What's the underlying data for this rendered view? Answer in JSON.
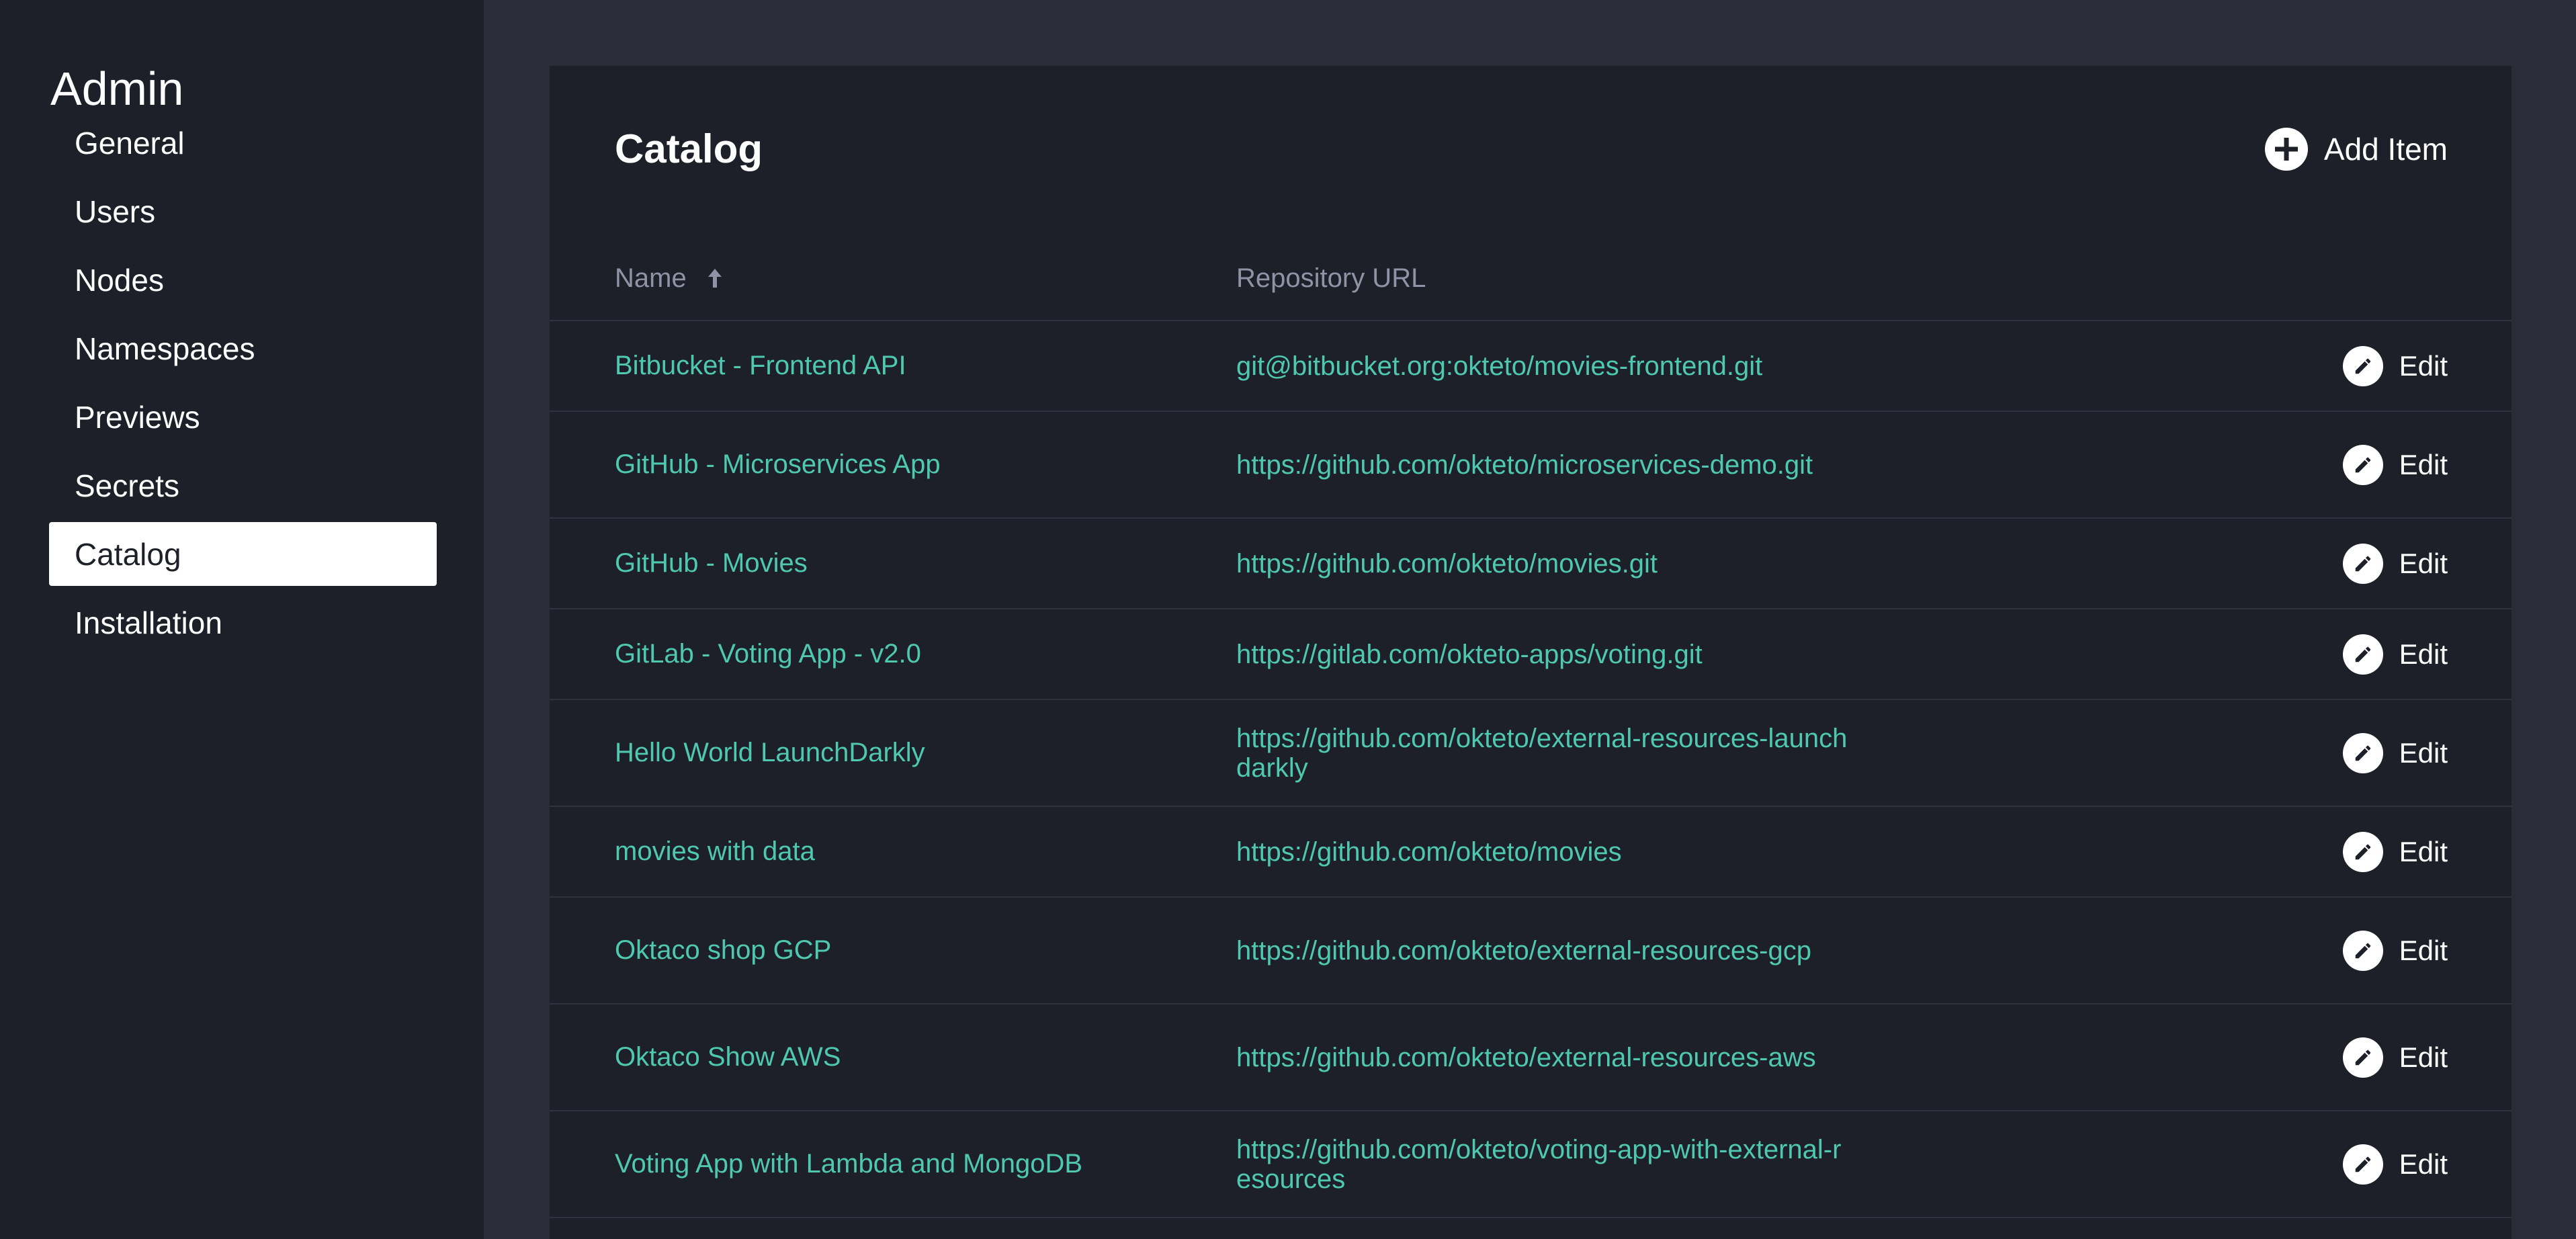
{
  "sidebar": {
    "title": "Admin",
    "items": [
      {
        "label": "General"
      },
      {
        "label": "Users"
      },
      {
        "label": "Nodes"
      },
      {
        "label": "Namespaces"
      },
      {
        "label": "Previews"
      },
      {
        "label": "Secrets"
      },
      {
        "label": "Catalog",
        "active": true
      },
      {
        "label": "Installation"
      }
    ]
  },
  "main": {
    "title": "Catalog",
    "add_item_label": "Add Item",
    "columns": {
      "name": "Name",
      "url": "Repository URL",
      "sort": "ascending"
    },
    "edit_label": "Edit",
    "rows": [
      {
        "name": "Bitbucket - Frontend API",
        "url": "git@bitbucket.org:okteto/movies-frontend.git"
      },
      {
        "name": "GitHub - Microservices App",
        "url": "https://github.com/okteto/microservices-demo.git"
      },
      {
        "name": "GitHub - Movies",
        "url": "https://github.com/okteto/movies.git"
      },
      {
        "name": "GitLab - Voting App - v2.0",
        "url": "https://gitlab.com/okteto-apps/voting.git"
      },
      {
        "name": "Hello World LaunchDarkly",
        "url": "https://github.com/okteto/external-resources-launchdarkly"
      },
      {
        "name": "movies with data",
        "url": "https://github.com/okteto/movies"
      },
      {
        "name": "Oktaco shop GCP",
        "url": "https://github.com/okteto/external-resources-gcp"
      },
      {
        "name": "Oktaco Show AWS",
        "url": "https://github.com/okteto/external-resources-aws"
      },
      {
        "name": "Voting App with Lambda and MongoDB",
        "url": "https://github.com/okteto/voting-app-with-external-resources"
      }
    ]
  },
  "colors": {
    "background": "#2a2d38",
    "panel": "#1e2029",
    "accent": "#4ec9b0",
    "muted_text": "#8e93a6"
  },
  "icons": {
    "add": "plus-circle-icon",
    "edit": "pencil-icon",
    "sort": "arrow-up-icon"
  }
}
